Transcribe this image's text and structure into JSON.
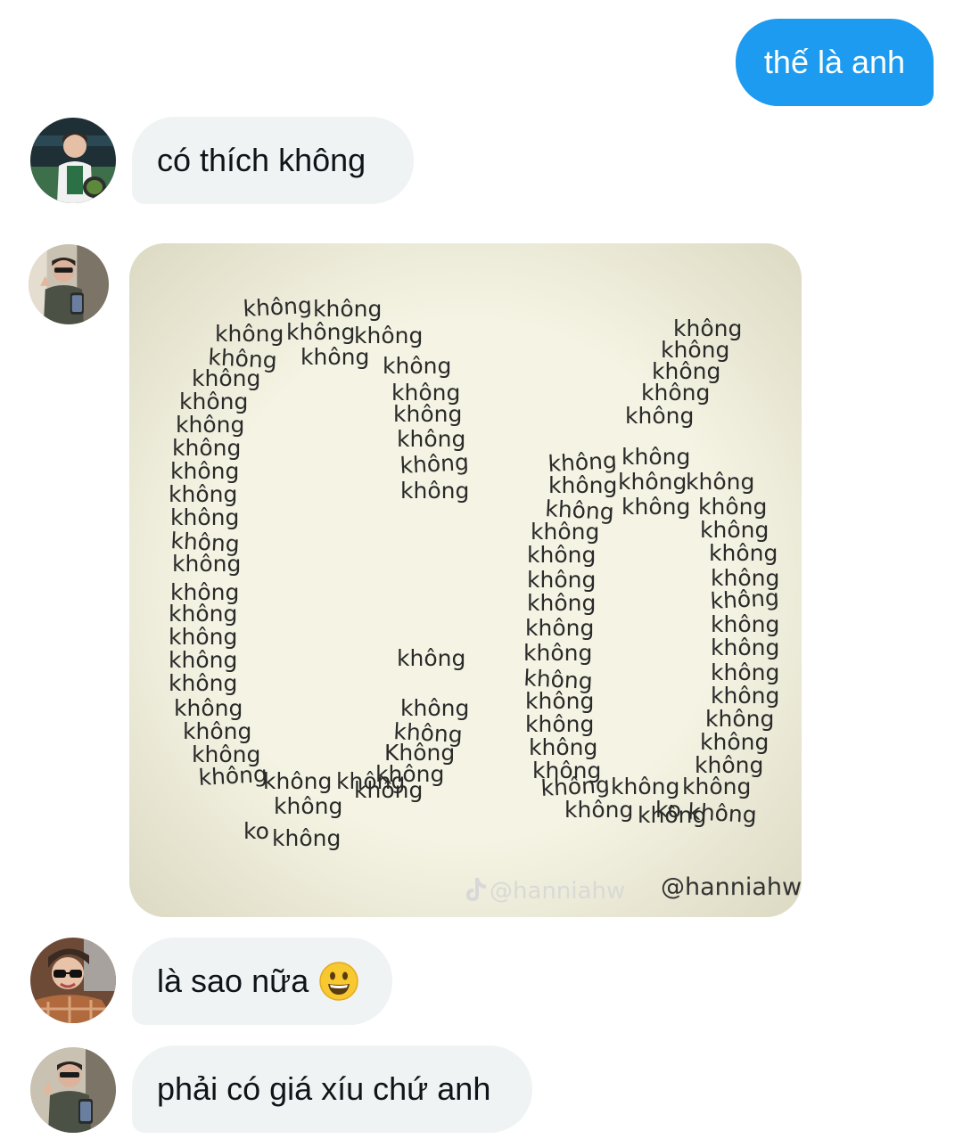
{
  "messages": [
    {
      "type": "sent",
      "text": "thế là anh"
    },
    {
      "type": "received",
      "text": "có thích không"
    },
    {
      "type": "received_image",
      "image": {
        "big_text": "Có",
        "word": "không",
        "word_variants": [
          "ko",
          "Không"
        ],
        "watermark_left": "@hanniahw",
        "watermark_right": "@hanniahw",
        "watermark_icon": "tiktok-logo"
      }
    },
    {
      "type": "received",
      "text": "là sao nữa",
      "emoji": "grinning-face"
    },
    {
      "type": "received",
      "text": "phải có giá xíu chứ anh"
    }
  ],
  "colors": {
    "sent_bubble": "#1d9bf0",
    "received_bubble": "#eff3f4",
    "text_dark": "#0f1419"
  }
}
